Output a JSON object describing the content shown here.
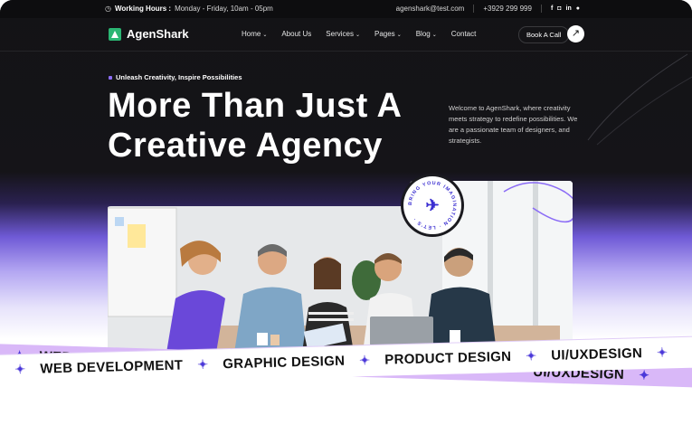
{
  "topbar": {
    "hours_label": "Working Hours :",
    "hours_value": "Monday - Friday, 10am - 05pm",
    "email": "agenshark@test.com",
    "phone": "+3929 299 999",
    "social": [
      "f",
      "ig",
      "in",
      "wa"
    ]
  },
  "nav": {
    "brand": "AgenShark",
    "items": [
      {
        "label": "Home",
        "dropdown": true
      },
      {
        "label": "About Us",
        "dropdown": false
      },
      {
        "label": "Services",
        "dropdown": true
      },
      {
        "label": "Pages",
        "dropdown": true
      },
      {
        "label": "Blog",
        "dropdown": true
      },
      {
        "label": "Contact",
        "dropdown": false
      }
    ],
    "cta_label": "Book A Call",
    "cta_icon": "arrow-up-right-icon"
  },
  "hero": {
    "tagline": "Unleash Creativity, Inspire Possibilities",
    "headline_line1": "More Than Just A",
    "headline_line2": "Creative Agency",
    "intro": "Welcome to AgenShark, where creativity meets strategy to redefine possibilities. We are a passionate team of designers, and strategists.",
    "badge_text": "BRING YOUR IMAGINATION · LET'S ·"
  },
  "ribbon": {
    "top_items": [
      "WEB DEVELOPMENT",
      "UI/UXDESIGN"
    ],
    "bottom_items": [
      "WEB DEVELOPMENT",
      "GRAPHIC DESIGN",
      "PRODUCT DESIGN",
      "UI/UXDESIGN"
    ]
  },
  "colors": {
    "accent": "#4a37d9",
    "brand_green": "#2bb673",
    "dark_bg": "#131316",
    "ribbon_purple": "#d9b8f8"
  }
}
